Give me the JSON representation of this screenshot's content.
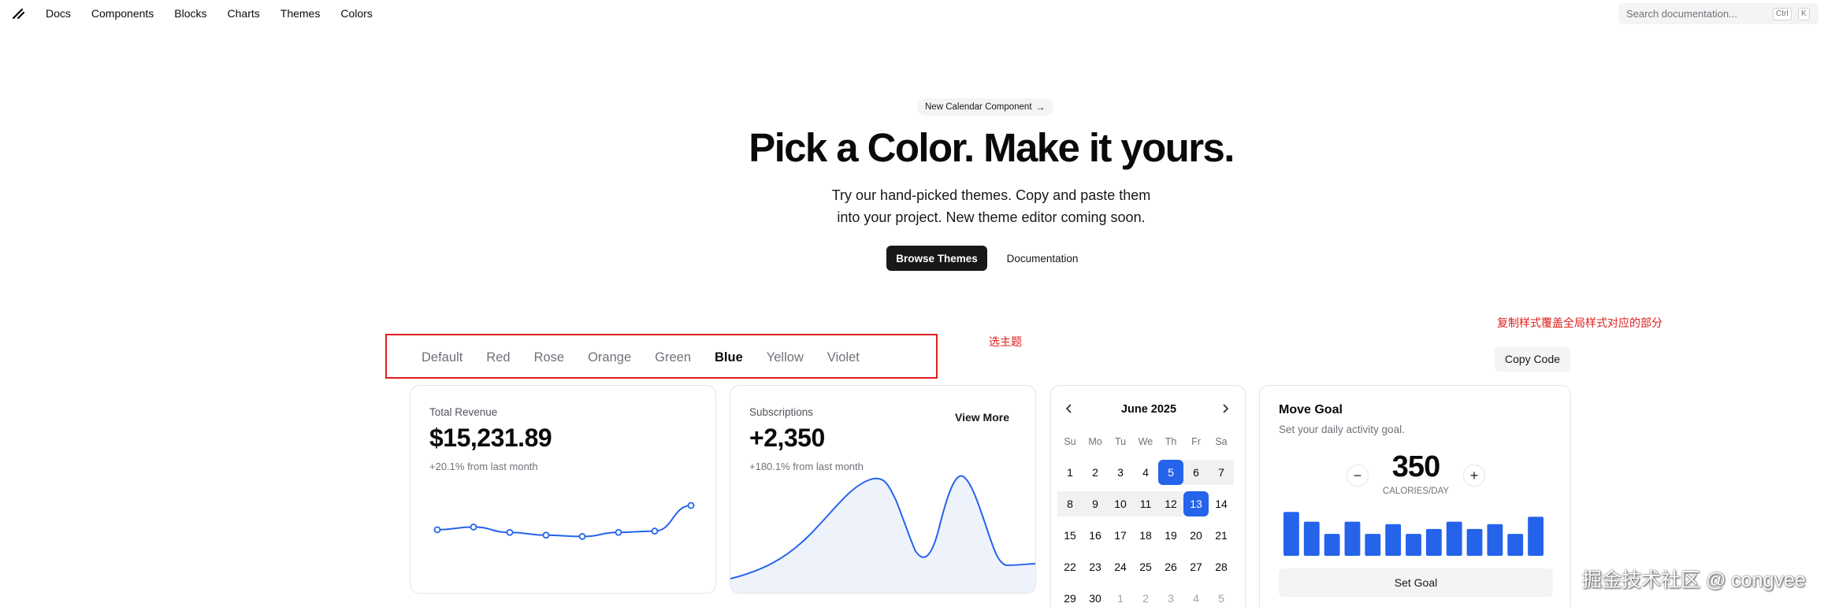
{
  "nav": {
    "links": [
      "Docs",
      "Components",
      "Blocks",
      "Charts",
      "Themes",
      "Colors"
    ],
    "search_placeholder": "Search documentation...",
    "kbd_ctrl": "Ctrl",
    "kbd_k": "K"
  },
  "hero": {
    "pill": "New Calendar Component",
    "pill_arrow": "→",
    "title": "Pick a Color. Make it yours.",
    "subtitle_line1": "Try our hand-picked themes. Copy and paste them",
    "subtitle_line2": "into your project. New theme editor coming soon.",
    "browse_button": "Browse Themes",
    "docs_button": "Documentation"
  },
  "annotations": {
    "pick_theme": "选主题",
    "copy_note": "复制样式覆盖全局样式对应的部分"
  },
  "themes": {
    "tabs": [
      "Default",
      "Red",
      "Rose",
      "Orange",
      "Green",
      "Blue",
      "Yellow",
      "Violet"
    ],
    "active": "Blue",
    "copy_button": "Copy Code"
  },
  "colors": {
    "accent": "#2563eb",
    "annotation": "#e11d1d"
  },
  "revenue": {
    "label": "Total Revenue",
    "value": "$15,231.89",
    "delta": "+20.1% from last month",
    "sparkline": [
      40,
      38,
      42,
      44,
      45,
      42,
      41,
      22
    ]
  },
  "subscriptions": {
    "label": "Subscriptions",
    "value": "+2,350",
    "delta": "+180.1% from last month",
    "view_more": "View More"
  },
  "calendar": {
    "month": "June 2025",
    "dow": [
      "Su",
      "Mo",
      "Tu",
      "We",
      "Th",
      "Fr",
      "Sa"
    ],
    "weeks": [
      [
        "1",
        "2",
        "3",
        "4",
        "5",
        "6",
        "7"
      ],
      [
        "8",
        "9",
        "10",
        "11",
        "12",
        "13",
        "14"
      ],
      [
        "15",
        "16",
        "17",
        "18",
        "19",
        "20",
        "21"
      ],
      [
        "22",
        "23",
        "24",
        "25",
        "26",
        "27",
        "28"
      ],
      [
        "29",
        "30",
        "1",
        "2",
        "3",
        "4",
        "5"
      ]
    ],
    "selected": [
      "5",
      "13"
    ]
  },
  "goal": {
    "title": "Move Goal",
    "description": "Set your daily activity goal.",
    "minus": "−",
    "plus": "+",
    "value": "350",
    "unit": "CALORIES/DAY",
    "bars": [
      0.9,
      0.7,
      0.45,
      0.7,
      0.45,
      0.65,
      0.45,
      0.55,
      0.7,
      0.55,
      0.65,
      0.45,
      0.8
    ],
    "button": "Set Goal"
  },
  "watermark": "掘金技术社区 @ congvee"
}
